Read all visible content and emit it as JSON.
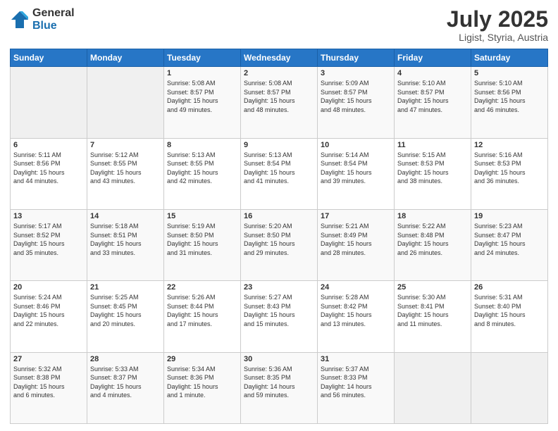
{
  "logo": {
    "general": "General",
    "blue": "Blue"
  },
  "header": {
    "month_year": "July 2025",
    "location": "Ligist, Styria, Austria"
  },
  "weekdays": [
    "Sunday",
    "Monday",
    "Tuesday",
    "Wednesday",
    "Thursday",
    "Friday",
    "Saturday"
  ],
  "weeks": [
    [
      {
        "day": "",
        "info": ""
      },
      {
        "day": "",
        "info": ""
      },
      {
        "day": "1",
        "info": "Sunrise: 5:08 AM\nSunset: 8:57 PM\nDaylight: 15 hours\nand 49 minutes."
      },
      {
        "day": "2",
        "info": "Sunrise: 5:08 AM\nSunset: 8:57 PM\nDaylight: 15 hours\nand 48 minutes."
      },
      {
        "day": "3",
        "info": "Sunrise: 5:09 AM\nSunset: 8:57 PM\nDaylight: 15 hours\nand 48 minutes."
      },
      {
        "day": "4",
        "info": "Sunrise: 5:10 AM\nSunset: 8:57 PM\nDaylight: 15 hours\nand 47 minutes."
      },
      {
        "day": "5",
        "info": "Sunrise: 5:10 AM\nSunset: 8:56 PM\nDaylight: 15 hours\nand 46 minutes."
      }
    ],
    [
      {
        "day": "6",
        "info": "Sunrise: 5:11 AM\nSunset: 8:56 PM\nDaylight: 15 hours\nand 44 minutes."
      },
      {
        "day": "7",
        "info": "Sunrise: 5:12 AM\nSunset: 8:55 PM\nDaylight: 15 hours\nand 43 minutes."
      },
      {
        "day": "8",
        "info": "Sunrise: 5:13 AM\nSunset: 8:55 PM\nDaylight: 15 hours\nand 42 minutes."
      },
      {
        "day": "9",
        "info": "Sunrise: 5:13 AM\nSunset: 8:54 PM\nDaylight: 15 hours\nand 41 minutes."
      },
      {
        "day": "10",
        "info": "Sunrise: 5:14 AM\nSunset: 8:54 PM\nDaylight: 15 hours\nand 39 minutes."
      },
      {
        "day": "11",
        "info": "Sunrise: 5:15 AM\nSunset: 8:53 PM\nDaylight: 15 hours\nand 38 minutes."
      },
      {
        "day": "12",
        "info": "Sunrise: 5:16 AM\nSunset: 8:53 PM\nDaylight: 15 hours\nand 36 minutes."
      }
    ],
    [
      {
        "day": "13",
        "info": "Sunrise: 5:17 AM\nSunset: 8:52 PM\nDaylight: 15 hours\nand 35 minutes."
      },
      {
        "day": "14",
        "info": "Sunrise: 5:18 AM\nSunset: 8:51 PM\nDaylight: 15 hours\nand 33 minutes."
      },
      {
        "day": "15",
        "info": "Sunrise: 5:19 AM\nSunset: 8:50 PM\nDaylight: 15 hours\nand 31 minutes."
      },
      {
        "day": "16",
        "info": "Sunrise: 5:20 AM\nSunset: 8:50 PM\nDaylight: 15 hours\nand 29 minutes."
      },
      {
        "day": "17",
        "info": "Sunrise: 5:21 AM\nSunset: 8:49 PM\nDaylight: 15 hours\nand 28 minutes."
      },
      {
        "day": "18",
        "info": "Sunrise: 5:22 AM\nSunset: 8:48 PM\nDaylight: 15 hours\nand 26 minutes."
      },
      {
        "day": "19",
        "info": "Sunrise: 5:23 AM\nSunset: 8:47 PM\nDaylight: 15 hours\nand 24 minutes."
      }
    ],
    [
      {
        "day": "20",
        "info": "Sunrise: 5:24 AM\nSunset: 8:46 PM\nDaylight: 15 hours\nand 22 minutes."
      },
      {
        "day": "21",
        "info": "Sunrise: 5:25 AM\nSunset: 8:45 PM\nDaylight: 15 hours\nand 20 minutes."
      },
      {
        "day": "22",
        "info": "Sunrise: 5:26 AM\nSunset: 8:44 PM\nDaylight: 15 hours\nand 17 minutes."
      },
      {
        "day": "23",
        "info": "Sunrise: 5:27 AM\nSunset: 8:43 PM\nDaylight: 15 hours\nand 15 minutes."
      },
      {
        "day": "24",
        "info": "Sunrise: 5:28 AM\nSunset: 8:42 PM\nDaylight: 15 hours\nand 13 minutes."
      },
      {
        "day": "25",
        "info": "Sunrise: 5:30 AM\nSunset: 8:41 PM\nDaylight: 15 hours\nand 11 minutes."
      },
      {
        "day": "26",
        "info": "Sunrise: 5:31 AM\nSunset: 8:40 PM\nDaylight: 15 hours\nand 8 minutes."
      }
    ],
    [
      {
        "day": "27",
        "info": "Sunrise: 5:32 AM\nSunset: 8:38 PM\nDaylight: 15 hours\nand 6 minutes."
      },
      {
        "day": "28",
        "info": "Sunrise: 5:33 AM\nSunset: 8:37 PM\nDaylight: 15 hours\nand 4 minutes."
      },
      {
        "day": "29",
        "info": "Sunrise: 5:34 AM\nSunset: 8:36 PM\nDaylight: 15 hours\nand 1 minute."
      },
      {
        "day": "30",
        "info": "Sunrise: 5:36 AM\nSunset: 8:35 PM\nDaylight: 14 hours\nand 59 minutes."
      },
      {
        "day": "31",
        "info": "Sunrise: 5:37 AM\nSunset: 8:33 PM\nDaylight: 14 hours\nand 56 minutes."
      },
      {
        "day": "",
        "info": ""
      },
      {
        "day": "",
        "info": ""
      }
    ]
  ]
}
